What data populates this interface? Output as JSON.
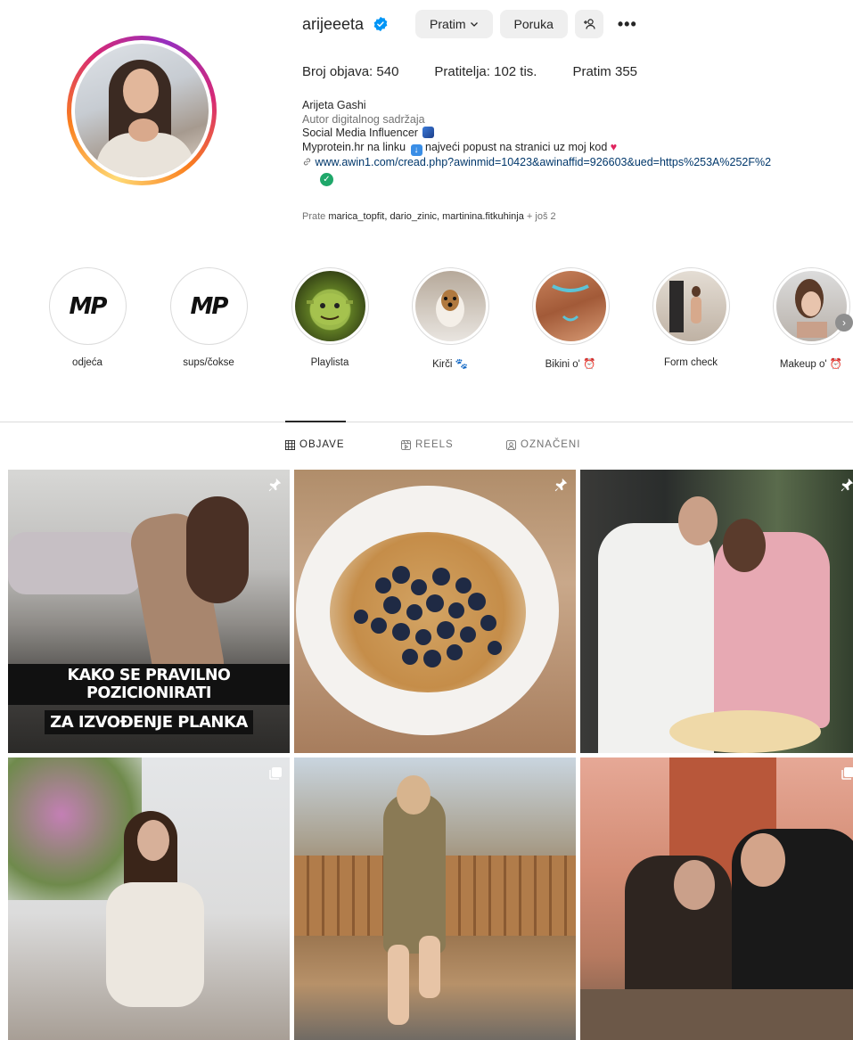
{
  "profile": {
    "username": "arijeeeta",
    "buttons": {
      "following": "Pratim",
      "message": "Poruka",
      "add_user": "+ዶ",
      "more": "•••"
    },
    "stats": {
      "posts": "Broj objava: 540",
      "followers": "Pratitelja: 102 tis.",
      "following": "Pratim 355"
    },
    "bio": {
      "name": "Arijeta Gashi",
      "category": "Autor digitalnog sadržaja",
      "line1": "Social Media Influencer",
      "line2_a": "Myprotein.hr na linku",
      "line2_b": "najveći popust na stranici uz moj kod",
      "link": "www.awin1.com/cread.php?awinmid=10423&awinaffid=926603&ued=https%253A%252F%2"
    },
    "followed_by_prefix": "Prate",
    "followed_by_names": "marica_topfit, dario_zinic, martinina.fitkuhinja",
    "followed_by_suffix": "+ još 2"
  },
  "highlights": [
    {
      "label": "odjeća"
    },
    {
      "label": "sups/čokse"
    },
    {
      "label": "Playlista"
    },
    {
      "label": "Kirči 🐾"
    },
    {
      "label": "Bikini o' ⏰"
    },
    {
      "label": "Form check"
    },
    {
      "label": "Makeup o' ⏰"
    }
  ],
  "highlight_logo_text": "MP",
  "tabs": {
    "posts": "OBJAVE",
    "reels": "REELS",
    "tagged": "OZNAČENI"
  },
  "posts": {
    "p1_line1": "KAKO SE PRAVILNO POZICIONIRATI",
    "p1_line2": "ZA IZVOĐENJE PLANKA"
  },
  "colors": {
    "verified": "#0095f6",
    "link": "#00376b",
    "muted": "#737373",
    "button_bg": "#efefef"
  }
}
